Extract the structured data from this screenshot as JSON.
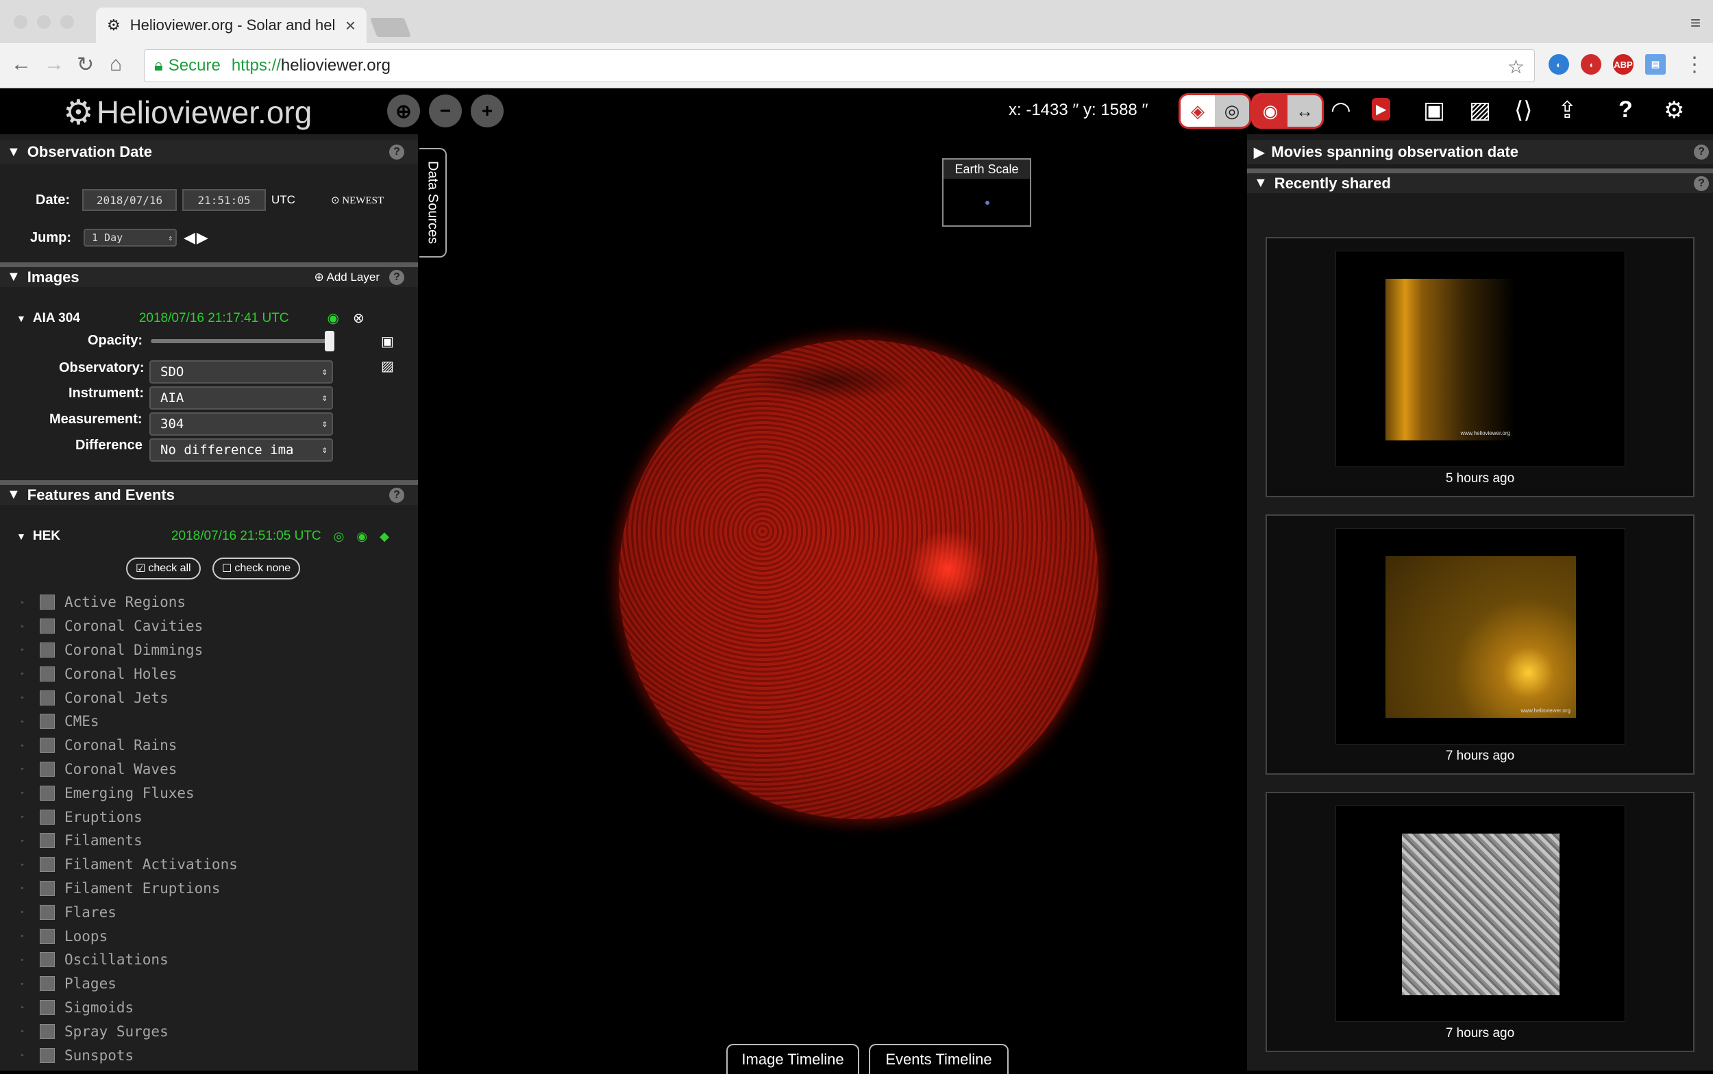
{
  "browser": {
    "tab_title": "Helioviewer.org - Solar and hel",
    "secure": "Secure",
    "url_scheme": "https://",
    "url_host": "helioviewer.org",
    "ext_abp": "ABP"
  },
  "header": {
    "logo": "Helioviewer.org",
    "coords": "x: -1433 ′′  y: 1588 ′′",
    "help": "?"
  },
  "obs": {
    "title": "Observation Date",
    "date_label": "Date:",
    "date": "2018/07/16",
    "time": "21:51:05",
    "utc": "UTC",
    "newest": "NEWEST",
    "jump_label": "Jump:",
    "jump_value": "1 Day"
  },
  "images": {
    "title": "Images",
    "add_layer": "Add Layer",
    "layer_name": "AIA 304",
    "layer_time": "2018/07/16 21:17:41 UTC",
    "opacity_label": "Opacity:",
    "opacity": 1.0,
    "observatory_label": "Observatory:",
    "observatory": "SDO",
    "instrument_label": "Instrument:",
    "instrument": "AIA",
    "measurement_label": "Measurement:",
    "measurement": "304",
    "difference_label": "Difference",
    "difference": "No difference ima"
  },
  "features": {
    "title": "Features and Events",
    "source": "HEK",
    "time": "2018/07/16 21:51:05 UTC",
    "check_all": "check all",
    "check_none": "check none",
    "events": [
      "Active Regions",
      "Coronal Cavities",
      "Coronal Dimmings",
      "Coronal Holes",
      "Coronal Jets",
      "CMEs",
      "Coronal Rains",
      "Coronal Waves",
      "Emerging Fluxes",
      "Eruptions",
      "Filaments",
      "Filament Activations",
      "Filament Eruptions",
      "Flares",
      "Loops",
      "Oscillations",
      "Plages",
      "Sigmoids",
      "Spray Surges",
      "Sunspots"
    ]
  },
  "viewport": {
    "data_sources": "Data Sources",
    "earth_scale": "Earth Scale",
    "image_timeline": "Image Timeline",
    "events_timeline": "Events Timeline"
  },
  "right": {
    "movies_title": "Movies spanning observation date",
    "shared_title": "Recently shared",
    "cards": [
      {
        "time": "5 hours ago"
      },
      {
        "time": "7 hours ago"
      },
      {
        "time": "7 hours ago"
      }
    ],
    "watermark": "www.helioviewer.org"
  },
  "colors": {
    "accent_red": "#d12a2a",
    "green": "#2bd12b",
    "panel": "#1f1f1f"
  }
}
